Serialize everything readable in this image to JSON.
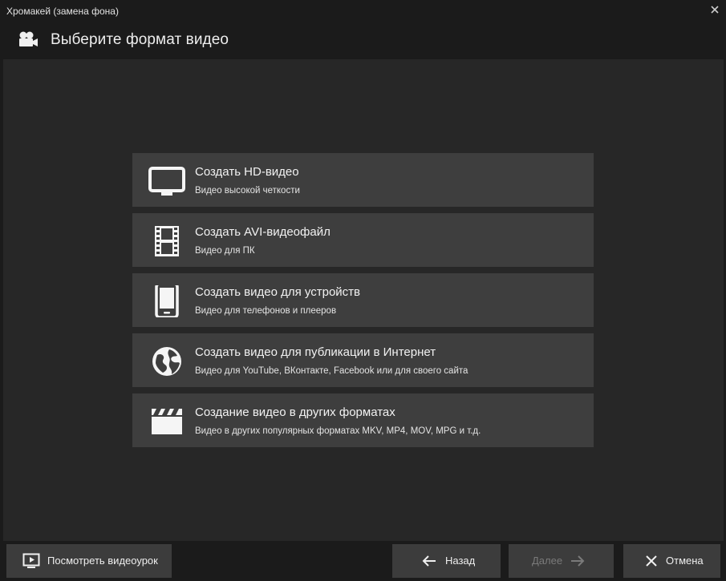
{
  "window": {
    "title": "Хромакей (замена фона)"
  },
  "header": {
    "icon": "video-camera-icon",
    "title": "Выберите формат видео"
  },
  "options": [
    {
      "icon": "monitor-icon",
      "title": "Создать HD-видео",
      "subtitle": "Видео высокой четкости"
    },
    {
      "icon": "film-strip-icon",
      "title": "Создать AVI-видеофайл",
      "subtitle": "Видео для ПК"
    },
    {
      "icon": "smartphone-icon",
      "title": "Создать видео для устройств",
      "subtitle": "Видео для телефонов и плееров"
    },
    {
      "icon": "globe-icon",
      "title": "Создать видео для публикации в Интернет",
      "subtitle": "Видео для YouTube, ВКонтакте, Facebook или для своего сайта"
    },
    {
      "icon": "clapperboard-icon",
      "title": "Создание видео в других форматах",
      "subtitle": "Видео в других популярных форматах MKV, MP4, MOV, MPG и т.д."
    }
  ],
  "footer": {
    "tutorial_label": "Посмотреть видеоурок",
    "back_label": "Назад",
    "next_label": "Далее",
    "cancel_label": "Отмена"
  },
  "colors": {
    "background": "#1b1b1b",
    "panel": "#272727",
    "option": "#3e3e3e",
    "button": "#3c3c3c"
  }
}
